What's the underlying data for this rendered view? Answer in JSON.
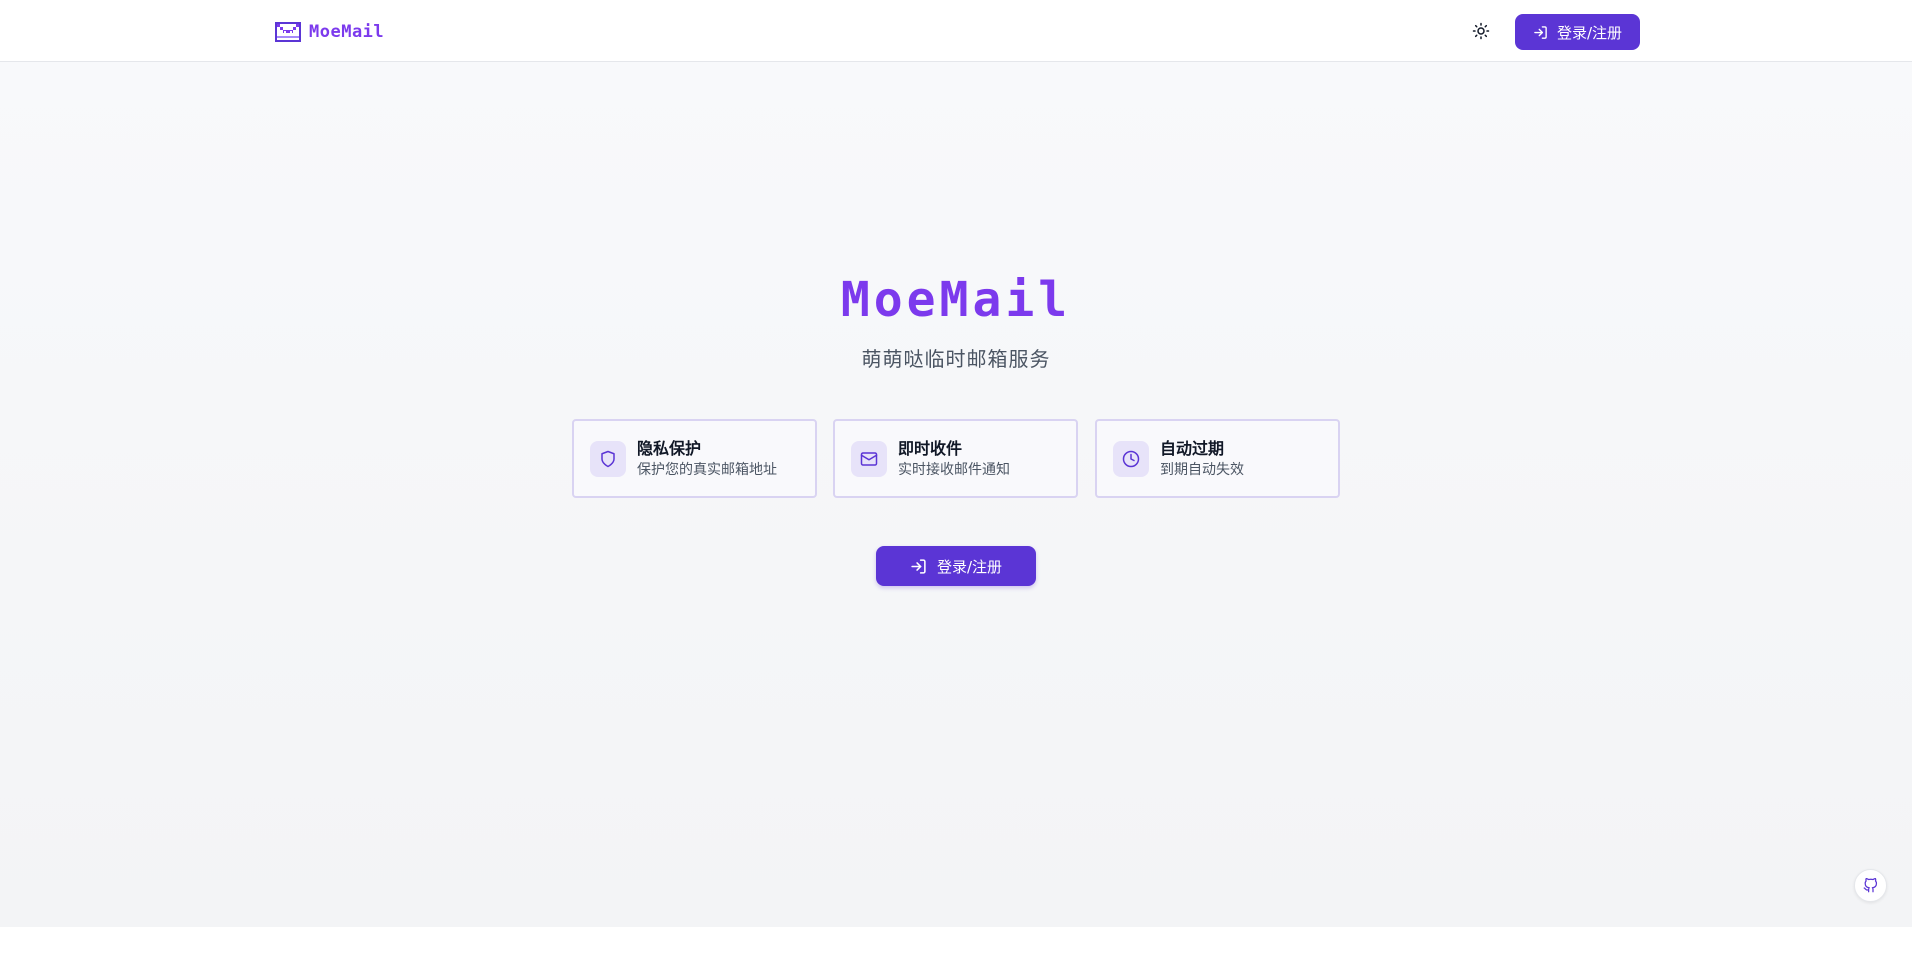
{
  "header": {
    "logo_text": "MoeMail",
    "theme_toggle_icon": "sun-icon",
    "login_label": "登录/注册",
    "login_icon": "log-in-icon"
  },
  "hero": {
    "title": "MoeMail",
    "subtitle": "萌萌哒临时邮箱服务"
  },
  "features": [
    {
      "icon": "shield-icon",
      "title": "隐私保护",
      "description": "保护您的真实邮箱地址"
    },
    {
      "icon": "mail-icon",
      "title": "即时收件",
      "description": "实时接收邮件通知"
    },
    {
      "icon": "clock-icon",
      "title": "自动过期",
      "description": "到期自动失效"
    }
  ],
  "cta": {
    "login_label": "登录/注册",
    "login_icon": "log-in-icon"
  },
  "floating": {
    "github_icon": "github-icon"
  },
  "colors": {
    "brand": "#7c3aed",
    "primary_button": "#5b35d5",
    "card_border": "#d9d3f2",
    "icon_bg": "#e7e3f9"
  }
}
